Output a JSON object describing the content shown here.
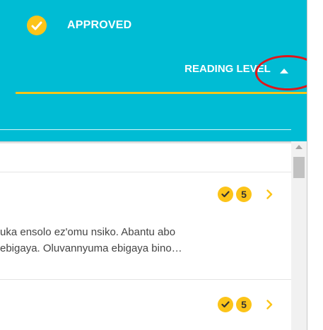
{
  "header": {
    "status_label": "APPROVED",
    "status_icon": "check-circle-icon",
    "tab_label": "READING LEVEL",
    "toggle_icon": "caret-up-icon"
  },
  "list": {
    "items": [
      {
        "approved": true,
        "level": "5",
        "excerpt": [
          "uka ensolo ez'omu nsiko. Abantu abo",
          "ebigaya. Oluvannyuma ebigaya bino…"
        ]
      },
      {
        "approved": true,
        "level": "5"
      }
    ]
  },
  "colors": {
    "header_bg": "#00bcd4",
    "accent_yellow": "#fcc419",
    "tab_underline": "#f5c518",
    "callout_red": "#e0151a"
  }
}
